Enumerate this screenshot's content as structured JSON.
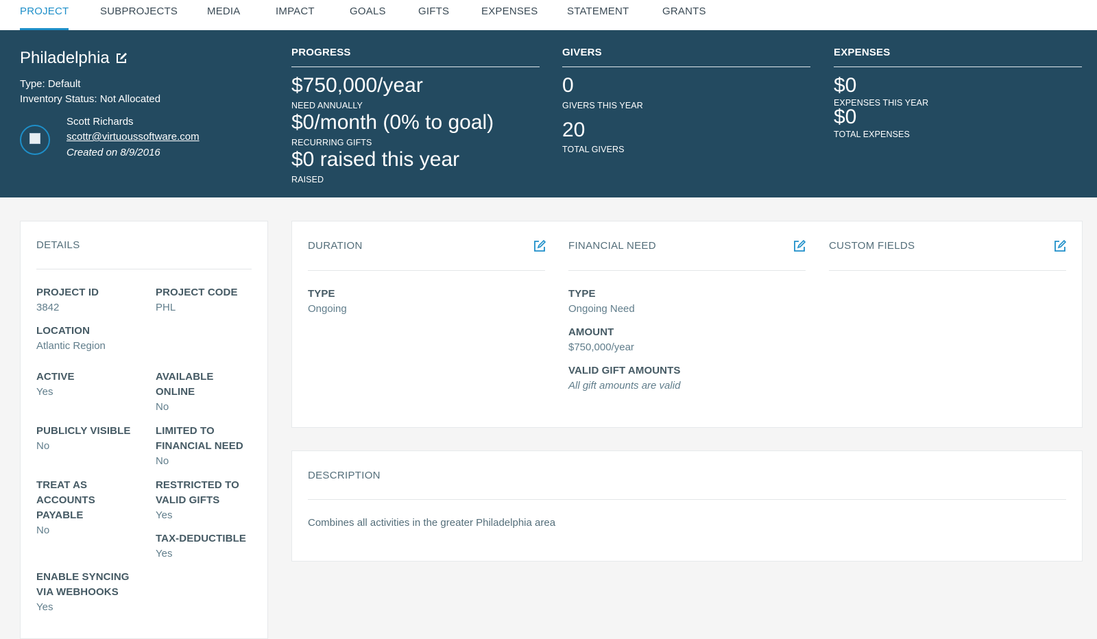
{
  "tabs": [
    {
      "label": "PROJECT",
      "active": true
    },
    {
      "label": "SUBPROJECTS"
    },
    {
      "label": "MEDIA"
    },
    {
      "label": "IMPACT"
    },
    {
      "label": "GOALS"
    },
    {
      "label": "GIFTS"
    },
    {
      "label": "EXPENSES"
    },
    {
      "label": "STATEMENT"
    },
    {
      "label": "GRANTS"
    }
  ],
  "project": {
    "title": "Philadelphia",
    "type": "Type: Default",
    "inventory_status": "Inventory Status: Not Allocated",
    "owner_name": "Scott Richards",
    "owner_email": "scottr@virtuoussoftware.com",
    "created": "Created on 8/9/2016"
  },
  "progress": {
    "heading": "PROGRESS",
    "need_value": "$750,000/year",
    "need_label": "NEED ANNUALLY",
    "recurring_value": "$0/month (0% to goal)",
    "recurring_label": "RECURRING GIFTS",
    "raised_value": "$0 raised this year",
    "raised_label": "RAISED",
    "percent_to_goal": 0
  },
  "givers": {
    "heading": "GIVERS",
    "this_year_value": "0",
    "this_year_label": "GIVERS THIS YEAR",
    "total_value": "20",
    "total_label": "TOTAL GIVERS"
  },
  "expenses": {
    "heading": "EXPENSES",
    "this_year_value": "$0",
    "this_year_label": "EXPENSES THIS YEAR",
    "total_value": "$0",
    "total_label": "TOTAL EXPENSES"
  },
  "details": {
    "title": "DETAILS",
    "project_id_label": "PROJECT ID",
    "project_id": "3842",
    "project_code_label": "PROJECT CODE",
    "project_code": "PHL",
    "location_label": "LOCATION",
    "location": "Atlantic Region",
    "active_label": "ACTIVE",
    "active": "Yes",
    "available_online_label_1": "AVAILABLE",
    "available_online_label_2": "ONLINE",
    "available_online": "No",
    "publicly_visible_label": "PUBLICLY VISIBLE",
    "publicly_visible": "No",
    "limited_label_1": "LIMITED TO",
    "limited_label_2": "FINANCIAL NEED",
    "limited": "No",
    "treat_label_1": "TREAT AS",
    "treat_label_2": "ACCOUNTS",
    "treat_label_3": "PAYABLE",
    "treat": "No",
    "restricted_label_1": "RESTRICTED TO",
    "restricted_label_2": "VALID GIFTS",
    "restricted": "Yes",
    "tax_label": "TAX-DEDUCTIBLE",
    "tax": "Yes",
    "sync_label_1": "ENABLE SYNCING",
    "sync_label_2": "VIA WEBHOOKS",
    "sync": "Yes"
  },
  "duration": {
    "title": "DURATION",
    "type_label": "TYPE",
    "type": "Ongoing"
  },
  "financial_need": {
    "title": "FINANCIAL NEED",
    "type_label": "TYPE",
    "type": "Ongoing Need",
    "amount_label": "AMOUNT",
    "amount": "$750,000/year",
    "valid_label": "VALID GIFT AMOUNTS",
    "valid": "All gift amounts are valid"
  },
  "custom_fields": {
    "title": "CUSTOM FIELDS"
  },
  "description": {
    "title": "DESCRIPTION",
    "text": "Combines all activities in the greater Philadelphia area"
  },
  "colors": {
    "accent": "#1e8fc9",
    "header_bg": "#234a60",
    "page_bg": "#f5f5f5"
  },
  "icons": {
    "edit": "edit-icon",
    "avatar": "avatar-image-placeholder"
  }
}
